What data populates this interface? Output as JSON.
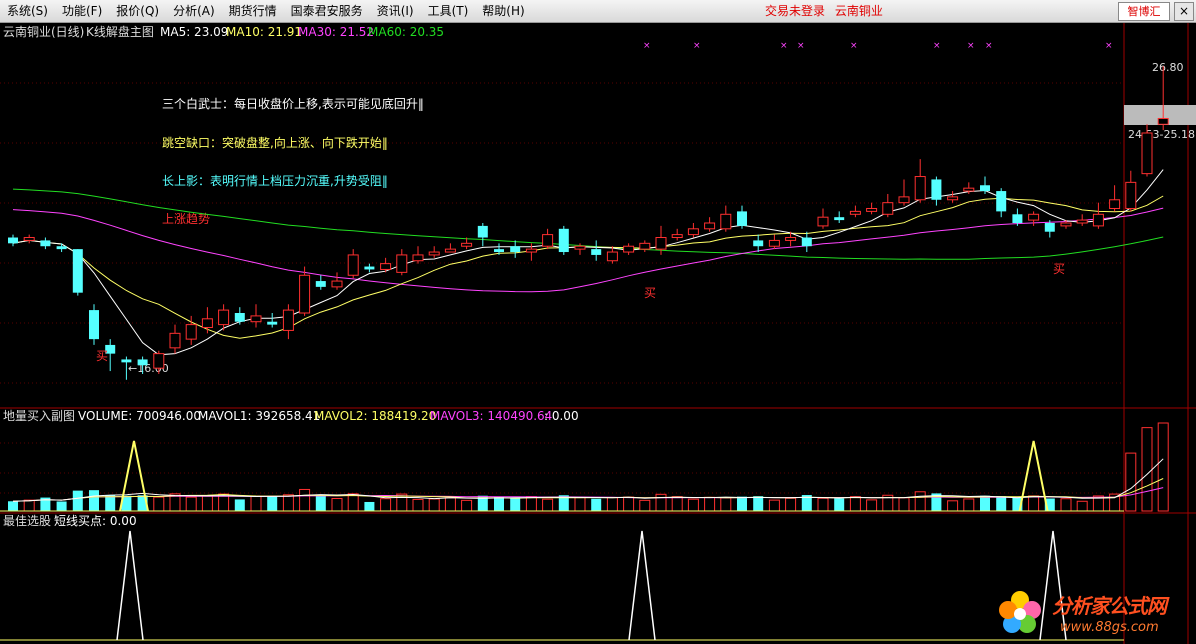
{
  "menubar": {
    "items": [
      {
        "label": "系统(S)",
        "name": "menu-system"
      },
      {
        "label": "功能(F)",
        "name": "menu-function"
      },
      {
        "label": "报价(Q)",
        "name": "menu-quote"
      },
      {
        "label": "分析(A)",
        "name": "menu-analysis"
      },
      {
        "label": "期货行情",
        "name": "menu-futures"
      },
      {
        "label": "国泰君安服务",
        "name": "menu-gtja-service"
      },
      {
        "label": "资讯(I)",
        "name": "menu-info"
      },
      {
        "label": "工具(T)",
        "name": "menu-tools"
      },
      {
        "label": "帮助(H)",
        "name": "menu-help"
      }
    ],
    "login_status": "交易未登录",
    "stock_name": "云南铜业",
    "zhibohui_label": "智博汇",
    "close_label": "×"
  },
  "main_panel": {
    "stock_title": "云南铜业(日线)",
    "indicator": "K线解盘主图",
    "ma_legend": [
      {
        "text": "MA5: 23.09",
        "color": "#ffffff"
      },
      {
        "text": "MA10: 21.91",
        "color": "#ffff66"
      },
      {
        "text": "MA30: 21.52",
        "color": "#ff44ff"
      },
      {
        "text": "MA60: 20.35",
        "color": "#22dd22"
      }
    ],
    "annotations": [
      {
        "text": "三个白武士：每日收盘价上移,表示可能见底回升‖",
        "color": "#ffffff"
      },
      {
        "text": "跳空缺口：突破盘整,向上涨、向下跌开始‖",
        "color": "#ffff66"
      },
      {
        "text": "长上影：表明行情上档压力沉重,升势受阻‖",
        "color": "#55ffff"
      },
      {
        "text": "上涨趋势",
        "color": "#ff3030"
      }
    ],
    "buy_label": "买",
    "low_label": "←16.00",
    "high_label": "26.80",
    "range_label": "24.53-25.18"
  },
  "volume_panel": {
    "title": "地量买入副图",
    "legend": [
      {
        "text": "VOLUME: 700946.00",
        "color": "#ffffff"
      },
      {
        "text": "MAVOL1: 392658.41",
        "color": "#ffffff"
      },
      {
        "text": "MAVOL2: 188419.20",
        "color": "#ffff66"
      },
      {
        "text": "MAVOL3: 140490.64",
        "color": "#ff44ff"
      },
      {
        "text": ": 0.00",
        "color": "#ffffff"
      }
    ]
  },
  "signal_panel": {
    "title": "最佳选股",
    "legend": "短线买点: 0.00"
  },
  "watermark": {
    "text": "分析家公式网",
    "url": "www.88gs.com"
  },
  "chart_data": {
    "type": "candlestick",
    "price_range": [
      15.2,
      27.6
    ],
    "colors": {
      "up": "#ff3030",
      "down": "#55ffff",
      "ma5": "#ffffff",
      "ma10": "#ffff66",
      "ma30": "#ff44ff",
      "ma60": "#22dd22"
    },
    "candles": [
      [
        20.9,
        20.7,
        21.0,
        20.6
      ],
      [
        20.8,
        20.9,
        21.0,
        20.7
      ],
      [
        20.8,
        20.6,
        20.9,
        20.5
      ],
      [
        20.6,
        20.5,
        20.7,
        20.4
      ],
      [
        20.5,
        19.0,
        20.5,
        18.9
      ],
      [
        18.4,
        17.4,
        18.6,
        17.2
      ],
      [
        17.2,
        16.9,
        17.4,
        16.3
      ],
      [
        16.7,
        16.6,
        16.8,
        16.0
      ],
      [
        16.7,
        16.5,
        16.8,
        16.2
      ],
      [
        16.4,
        16.9,
        17.0,
        16.2
      ],
      [
        17.1,
        17.6,
        17.9,
        16.9
      ],
      [
        17.4,
        17.9,
        18.2,
        17.2
      ],
      [
        17.8,
        18.1,
        18.5,
        17.6
      ],
      [
        17.9,
        18.4,
        18.6,
        17.7
      ],
      [
        18.3,
        18.0,
        18.5,
        17.9
      ],
      [
        18.0,
        18.2,
        18.6,
        17.8
      ],
      [
        18.0,
        17.9,
        18.3,
        17.8
      ],
      [
        17.7,
        18.4,
        18.6,
        17.4
      ],
      [
        18.3,
        19.6,
        19.9,
        18.2
      ],
      [
        19.4,
        19.2,
        19.6,
        19.1
      ],
      [
        19.2,
        19.4,
        19.7,
        19.1
      ],
      [
        19.6,
        20.3,
        20.5,
        19.5
      ],
      [
        19.9,
        19.8,
        20.0,
        19.7
      ],
      [
        19.8,
        20.0,
        20.2,
        19.7
      ],
      [
        19.7,
        20.3,
        20.5,
        19.6
      ],
      [
        20.1,
        20.3,
        20.6,
        20.0
      ],
      [
        20.3,
        20.4,
        20.6,
        20.2
      ],
      [
        20.4,
        20.5,
        20.7,
        20.4
      ],
      [
        20.6,
        20.7,
        20.9,
        20.5
      ],
      [
        21.3,
        20.9,
        21.4,
        20.6
      ],
      [
        20.5,
        20.4,
        20.7,
        20.3
      ],
      [
        20.6,
        20.4,
        20.8,
        20.2
      ],
      [
        20.4,
        20.5,
        20.7,
        20.1
      ],
      [
        20.6,
        21.0,
        21.2,
        20.5
      ],
      [
        21.2,
        20.4,
        21.3,
        20.3
      ],
      [
        20.5,
        20.6,
        20.7,
        20.3
      ],
      [
        20.5,
        20.3,
        20.8,
        20.1
      ],
      [
        20.1,
        20.4,
        20.6,
        20.0
      ],
      [
        20.4,
        20.6,
        20.7,
        20.3
      ],
      [
        20.5,
        20.7,
        20.8,
        20.4
      ],
      [
        20.5,
        20.9,
        21.3,
        20.3
      ],
      [
        20.9,
        21.0,
        21.2,
        20.8
      ],
      [
        21.0,
        21.2,
        21.4,
        20.9
      ],
      [
        21.2,
        21.4,
        21.6,
        21.1
      ],
      [
        21.2,
        21.7,
        22.0,
        21.1
      ],
      [
        21.8,
        21.3,
        22.0,
        21.2
      ],
      [
        20.8,
        20.6,
        21.0,
        20.4
      ],
      [
        20.6,
        20.8,
        21.0,
        20.5
      ],
      [
        20.8,
        20.9,
        21.1,
        20.6
      ],
      [
        20.9,
        20.6,
        21.1,
        20.4
      ],
      [
        21.3,
        21.6,
        21.9,
        21.2
      ],
      [
        21.6,
        21.5,
        21.8,
        21.4
      ],
      [
        21.7,
        21.8,
        22.0,
        21.6
      ],
      [
        21.8,
        21.9,
        22.1,
        21.7
      ],
      [
        21.7,
        22.1,
        22.4,
        21.6
      ],
      [
        22.1,
        22.3,
        22.9,
        22.0
      ],
      [
        22.2,
        23.0,
        23.6,
        22.1
      ],
      [
        22.9,
        22.2,
        23.0,
        22.0
      ],
      [
        22.2,
        22.3,
        22.5,
        22.1
      ],
      [
        22.5,
        22.6,
        22.8,
        22.4
      ],
      [
        22.7,
        22.5,
        23.0,
        22.4
      ],
      [
        22.5,
        21.8,
        22.6,
        21.6
      ],
      [
        21.7,
        21.4,
        21.9,
        21.3
      ],
      [
        21.5,
        21.7,
        21.8,
        21.3
      ],
      [
        21.4,
        21.1,
        21.5,
        20.9
      ],
      [
        21.3,
        21.4,
        21.5,
        21.2
      ],
      [
        21.4,
        21.5,
        21.7,
        21.3
      ],
      [
        21.3,
        21.7,
        22.1,
        21.2
      ],
      [
        21.9,
        22.2,
        22.7,
        21.8
      ],
      [
        21.9,
        22.8,
        23.2,
        21.8
      ],
      [
        23.1,
        24.5,
        24.8,
        23.0
      ],
      [
        24.8,
        25.0,
        26.8,
        24.6
      ]
    ],
    "buy_signal_indices": [
      5,
      38,
      63
    ],
    "volume_max": 760000
  }
}
